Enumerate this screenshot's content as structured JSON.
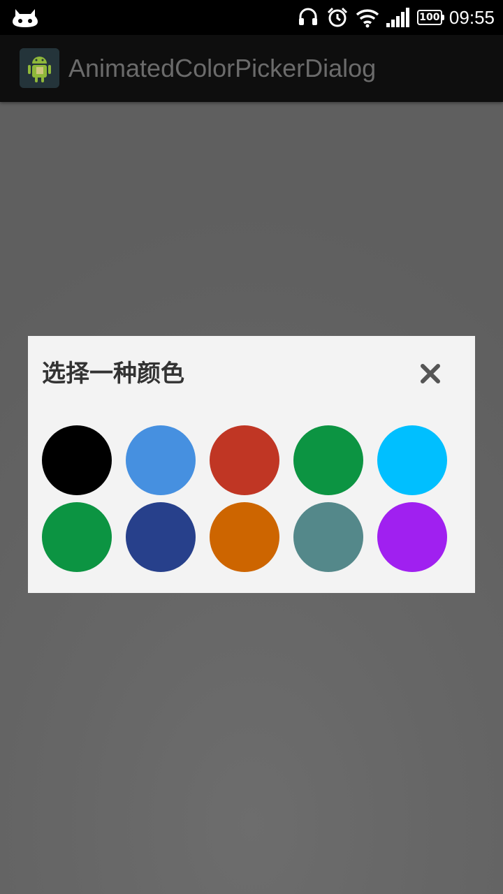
{
  "status_bar": {
    "time": "09:55",
    "battery": "100",
    "icons": [
      "android-cat-icon",
      "headset-icon",
      "alarm-icon",
      "wifi-icon",
      "signal-icon",
      "battery-icon"
    ]
  },
  "action_bar": {
    "title": "AnimatedColorPickerDialog",
    "icon": "app-launcher-icon"
  },
  "dialog": {
    "title": "选择一种颜色",
    "close_icon": "close-icon",
    "colors": [
      [
        "#000000",
        "#4690E0",
        "#C03624",
        "#0C9442",
        "#00BFFF"
      ],
      [
        "#0C9442",
        "#27408B",
        "#CD6500",
        "#54888A",
        "#A020F0"
      ]
    ]
  }
}
